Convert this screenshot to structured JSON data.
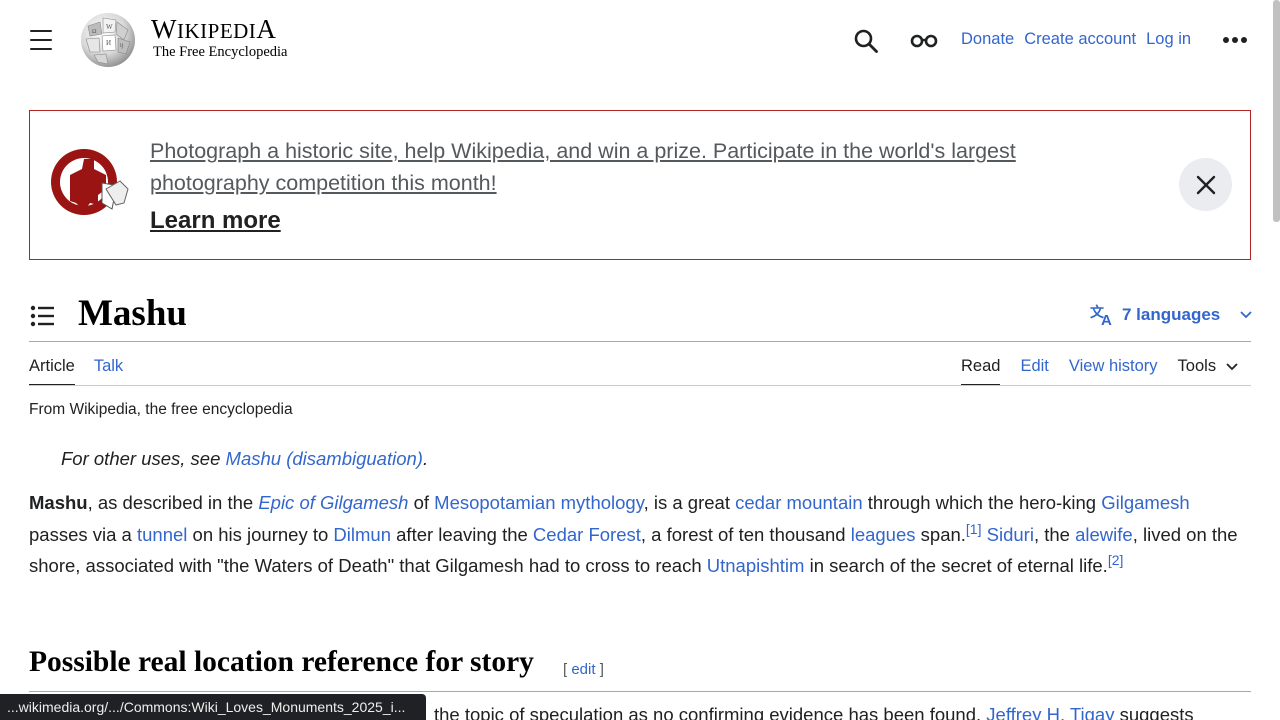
{
  "header": {
    "wordmark_first": "W",
    "wordmark_rest": "IKIPEDI",
    "wordmark_last": "A",
    "tagline": "The Free Encyclopedia",
    "links": {
      "donate": "Donate",
      "create_account": "Create account",
      "login": "Log in"
    }
  },
  "banner": {
    "text": "Photograph a historic site, help Wikipedia, and win a prize. Participate in the world's largest photography competition this month!",
    "learn_more": "Learn more"
  },
  "title": "Mashu",
  "languages": "7 languages",
  "tabs": {
    "article": "Article",
    "talk": "Talk",
    "read": "Read",
    "edit": "Edit",
    "history": "View history",
    "tools": "Tools"
  },
  "from": "From Wikipedia, the free encyclopedia",
  "hatnote": {
    "prefix": "For other uses, see ",
    "link": "Mashu (disambiguation)",
    "suffix": "."
  },
  "paragraph": {
    "t0": "Mashu",
    "t1": ", as described in the ",
    "l1": "Epic of Gilgamesh",
    "t2": " of ",
    "l2": "Mesopotamian mythology",
    "t3": ", is a great ",
    "l3": "cedar mountain",
    "t4": " through which the hero-king ",
    "l4": "Gilgamesh",
    "t5": " passes via a ",
    "l5": "tunnel",
    "t6": " on his journey to ",
    "l6": "Dilmun",
    "t7": " after leaving the ",
    "l7": "Cedar Forest",
    "t8": ", a forest of ten thousand ",
    "l8": "leagues",
    "t9": " span.",
    "ref1": "[1]",
    "t10": " ",
    "l9": "Siduri",
    "t11": ", the ",
    "l10": "alewife",
    "t12": ", lived on the shore, associated with \"the Waters of Death\" that Gilgamesh had to cross to reach ",
    "l11": "Utnapishtim",
    "t13": " in search of the secret of eternal life.",
    "ref2": "[2]"
  },
  "section": {
    "heading": "Possible real location reference for story",
    "edit_open": "[ ",
    "edit": "edit",
    "edit_close": " ]",
    "next_text": "the topic of speculation as no confirming evidence has been found. ",
    "next_link": "Jeffrey H. Tigay",
    "next_tail": " suggests"
  },
  "status_url": "...wikimedia.org/.../Commons:Wiki_Loves_Monuments_2025_i..."
}
